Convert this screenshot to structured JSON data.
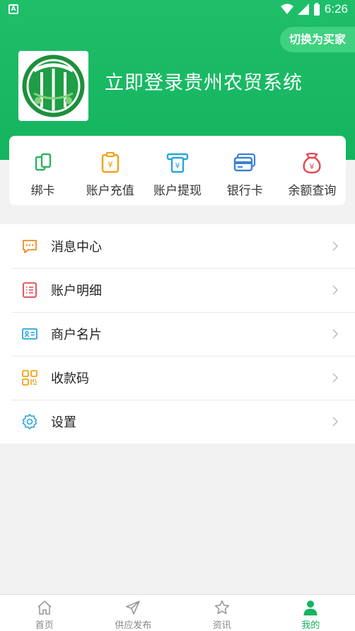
{
  "status_bar": {
    "time": "6:26"
  },
  "header": {
    "switch_label": "切换为买家",
    "login_title": "立即登录贵州农贸系统"
  },
  "quick_actions": [
    {
      "label": "绑卡",
      "icon": "bind-card-icon",
      "color": "#2bb35e"
    },
    {
      "label": "账户充值",
      "icon": "recharge-icon",
      "color": "#f0a21a"
    },
    {
      "label": "账户提现",
      "icon": "withdraw-icon",
      "color": "#28a6d9"
    },
    {
      "label": "银行卡",
      "icon": "bank-card-icon",
      "color": "#3b82d6"
    },
    {
      "label": "余额查询",
      "icon": "money-bag-icon",
      "color": "#e2474f"
    }
  ],
  "menu": [
    {
      "label": "消息中心",
      "icon": "message-icon",
      "color": "#f08a1c"
    },
    {
      "label": "账户明细",
      "icon": "list-icon",
      "color": "#e2474f"
    },
    {
      "label": "商户名片",
      "icon": "business-card-icon",
      "color": "#28a6d9"
    },
    {
      "label": "收款码",
      "icon": "qr-code-icon",
      "color": "#f0a21a"
    },
    {
      "label": "设置",
      "icon": "settings-icon",
      "color": "#28a6d9"
    }
  ],
  "tabs": [
    {
      "label": "首页",
      "icon": "home-icon"
    },
    {
      "label": "供应发布",
      "icon": "send-icon"
    },
    {
      "label": "资讯",
      "icon": "star-icon"
    },
    {
      "label": "我的",
      "icon": "user-icon",
      "active": true
    }
  ],
  "colors": {
    "brand": "#14b45f",
    "brand_light": "#3fd180"
  }
}
